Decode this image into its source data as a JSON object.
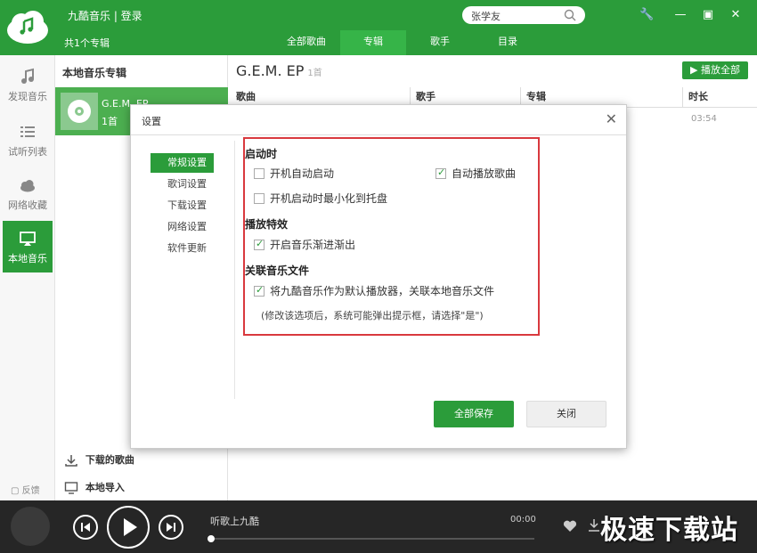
{
  "header": {
    "app_login": "九酷音乐 | 登录",
    "album_count": "共1个专辑",
    "search_value": "张学友",
    "nav_tabs": [
      "全部歌曲",
      "专辑",
      "歌手",
      "目录"
    ],
    "active_tab": "专辑"
  },
  "sidebar": {
    "items": [
      {
        "label": "发现音乐",
        "icon": "music-note-icon"
      },
      {
        "label": "试听列表",
        "icon": "list-icon"
      },
      {
        "label": "网络收藏",
        "icon": "cloud-icon"
      },
      {
        "label": "本地音乐",
        "icon": "monitor-icon"
      }
    ],
    "feedback": "反馈"
  },
  "album_panel": {
    "title": "本地音乐专辑",
    "album_name": "G.E.M. EP",
    "album_songs": "1首",
    "downloaded": "下载的歌曲",
    "local_import": "本地导入"
  },
  "main": {
    "title": "G.E.M. EP",
    "subtitle": "1首",
    "play_all": "▶ 播放全部",
    "columns": [
      "歌曲",
      "歌手",
      "专辑",
      "时长"
    ],
    "row_duration": "03:54"
  },
  "player": {
    "song_title": "听歌上九酷",
    "time": "00:00",
    "progress": 0,
    "watermark": "极速下载站"
  },
  "dialog": {
    "title": "设置",
    "nav": [
      "常规设置",
      "歌词设置",
      "下载设置",
      "网络设置",
      "软件更新"
    ],
    "active_nav": "常规设置",
    "sections": {
      "startup": {
        "title": "启动时",
        "auto_start": "开机自动启动",
        "auto_play": "自动播放歌曲",
        "minimize_tray": "开机启动时最小化到托盘"
      },
      "effects": {
        "title": "播放特效",
        "fade": "开启音乐渐进渐出"
      },
      "assoc": {
        "title": "关联音乐文件",
        "default_player": "将九酷音乐作为默认播放器，关联本地音乐文件",
        "note": "(修改该选项后，系统可能弹出提示框，请选择\"是\")"
      }
    },
    "save_all": "全部保存",
    "close": "关闭"
  },
  "colors": {
    "brand": "#2b9c3a",
    "highlight": "#d9393e"
  }
}
